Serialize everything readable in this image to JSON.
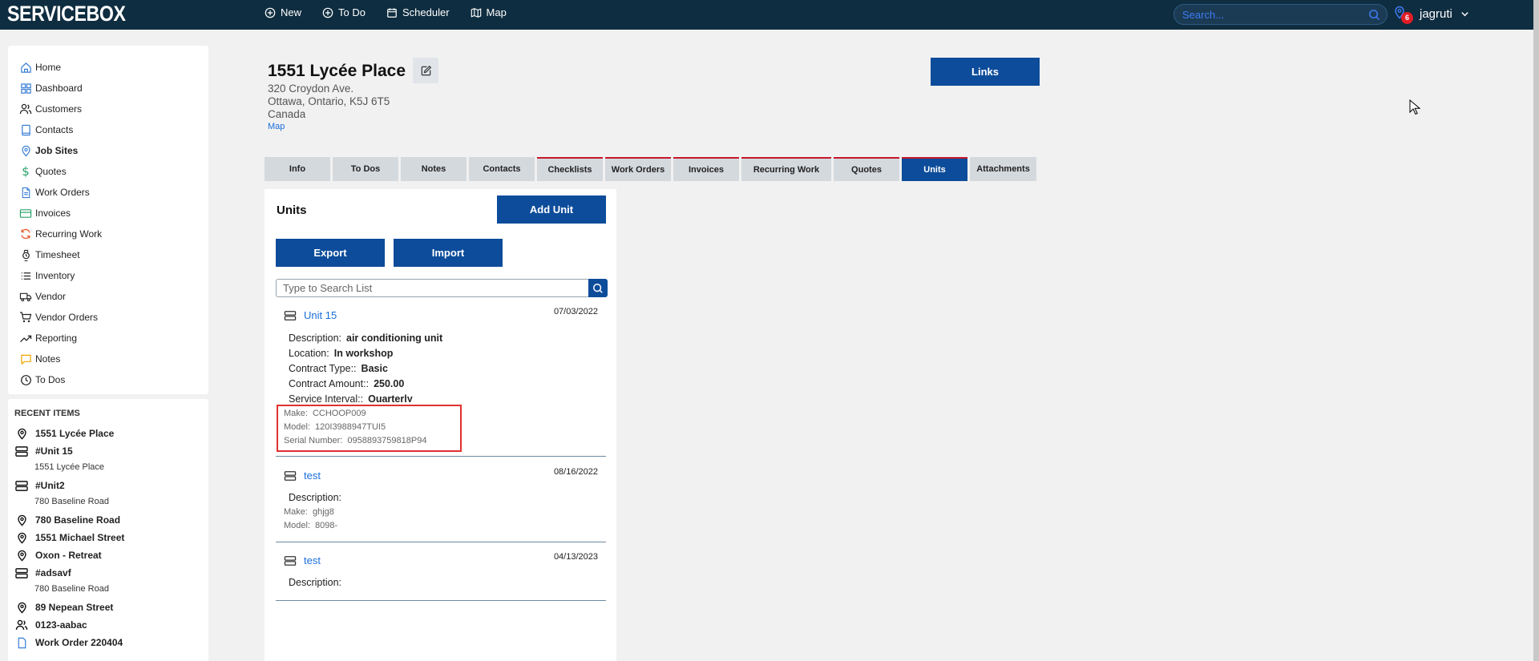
{
  "app": {
    "logo": "SERVICEBOX"
  },
  "topnav": {
    "items": [
      {
        "label": "New",
        "icon": "plus-circle-icon"
      },
      {
        "label": "To Do",
        "icon": "plus-circle-icon"
      },
      {
        "label": "Scheduler",
        "icon": "calendar-icon"
      },
      {
        "label": "Map",
        "icon": "map-icon"
      }
    ],
    "search_placeholder": "Search...",
    "notification_count": "6",
    "username": "jagruti"
  },
  "sidebar": {
    "items": [
      {
        "label": "Home",
        "icon": "home-icon",
        "color": "#3a7fd5"
      },
      {
        "label": "Dashboard",
        "icon": "grid-icon",
        "color": "#3a7fd5"
      },
      {
        "label": "Customers",
        "icon": "users-icon",
        "color": "#222222"
      },
      {
        "label": "Contacts",
        "icon": "book-icon",
        "color": "#3a7fd5"
      },
      {
        "label": "Job Sites",
        "icon": "location-pin-icon",
        "color": "#3a7fd5"
      },
      {
        "label": "Quotes",
        "icon": "dollar-icon",
        "color": "#2aa36b"
      },
      {
        "label": "Work Orders",
        "icon": "document-icon",
        "color": "#3a7fd5"
      },
      {
        "label": "Invoices",
        "icon": "card-icon",
        "color": "#2aa36b"
      },
      {
        "label": "Recurring Work",
        "icon": "refresh-icon",
        "color": "#e55a2b"
      },
      {
        "label": "Timesheet",
        "icon": "watch-icon",
        "color": "#222222"
      },
      {
        "label": "Inventory",
        "icon": "list-icon",
        "color": "#222222"
      },
      {
        "label": "Vendor",
        "icon": "truck-icon",
        "color": "#222222"
      },
      {
        "label": "Vendor Orders",
        "icon": "cart-icon",
        "color": "#222222"
      },
      {
        "label": "Reporting",
        "icon": "trending-up-icon",
        "color": "#222222"
      },
      {
        "label": "Notes",
        "icon": "note-icon",
        "color": "#f0a500"
      },
      {
        "label": "To Dos",
        "icon": "clock-icon",
        "color": "#222222"
      }
    ],
    "active": "Job Sites"
  },
  "recent": {
    "title": "RECENT ITEMS",
    "items": [
      {
        "label": "1551 Lycée Place",
        "icon": "location-pin-icon",
        "sub": ""
      },
      {
        "label": "#Unit 15",
        "icon": "server-icon",
        "sub": "1551 Lycée Place"
      },
      {
        "label": "#Unit2",
        "icon": "server-icon",
        "sub": "780 Baseline Road"
      },
      {
        "label": "780 Baseline Road",
        "icon": "location-pin-icon",
        "sub": ""
      },
      {
        "label": "1551 Michael Street",
        "icon": "location-pin-icon",
        "sub": ""
      },
      {
        "label": "Oxon - Retreat",
        "icon": "location-pin-icon",
        "sub": ""
      },
      {
        "label": "#adsavf",
        "icon": "server-icon",
        "sub": "780 Baseline Road"
      },
      {
        "label": "89 Nepean Street",
        "icon": "location-pin-icon",
        "sub": ""
      },
      {
        "label": "0123-aabac",
        "icon": "users-icon",
        "sub": ""
      },
      {
        "label": "Work Order 220404",
        "icon": "document-icon",
        "sub": ""
      }
    ]
  },
  "site": {
    "title": "1551 Lycée Place",
    "address_line1": "320 Croydon Ave.",
    "address_line2": "Ottawa, Ontario, K5J 6T5",
    "address_line3": "Canada",
    "map_link": "Map",
    "links_button": "Links"
  },
  "tabs": [
    {
      "label": "Info",
      "red": false,
      "active": false
    },
    {
      "label": "To Dos",
      "red": false,
      "active": false
    },
    {
      "label": "Notes",
      "red": false,
      "active": false
    },
    {
      "label": "Contacts",
      "red": false,
      "active": false
    },
    {
      "label": "Checklists",
      "red": true,
      "active": false
    },
    {
      "label": "Work Orders",
      "red": true,
      "active": false
    },
    {
      "label": "Invoices",
      "red": true,
      "active": false
    },
    {
      "label": "Recurring Work",
      "red": true,
      "active": false
    },
    {
      "label": "Quotes",
      "red": true,
      "active": false
    },
    {
      "label": "Units",
      "red": true,
      "active": true
    },
    {
      "label": "Attachments",
      "red": false,
      "active": false
    }
  ],
  "units": {
    "title": "Units",
    "add_button": "Add Unit",
    "export_button": "Export",
    "import_button": "Import",
    "search_placeholder": "Type to Search List",
    "list": [
      {
        "name": "Unit 15",
        "date": "07/03/2022",
        "description_label": "Description:",
        "description": "air conditioning unit",
        "location_label": "Location:",
        "location": "In workshop",
        "contract_type_label": "Contract Type::",
        "contract_type": "Basic",
        "contract_amount_label": "Contract Amount::",
        "contract_amount": "250.00",
        "service_interval_label": "Service Interval::",
        "service_interval": "Quarterly",
        "make_label": "Make:",
        "make": "CCHOOP009",
        "model_label": "Model:",
        "model": "120I3988947TUI5",
        "serial_label": "Serial Number:",
        "serial": "0958893759818P94"
      },
      {
        "name": "test",
        "date": "08/16/2022",
        "description_label": "Description:",
        "make_label": "Make:",
        "make": "ghjg8",
        "model_label": "Model:",
        "model": "8098-"
      },
      {
        "name": "test",
        "date": "04/13/2023",
        "description_label": "Description:"
      }
    ]
  },
  "colors": {
    "brand": "#0d4c9a",
    "topbar": "#0f2d40",
    "highlight": "#e03131",
    "tab_accent": "#c7172b"
  }
}
